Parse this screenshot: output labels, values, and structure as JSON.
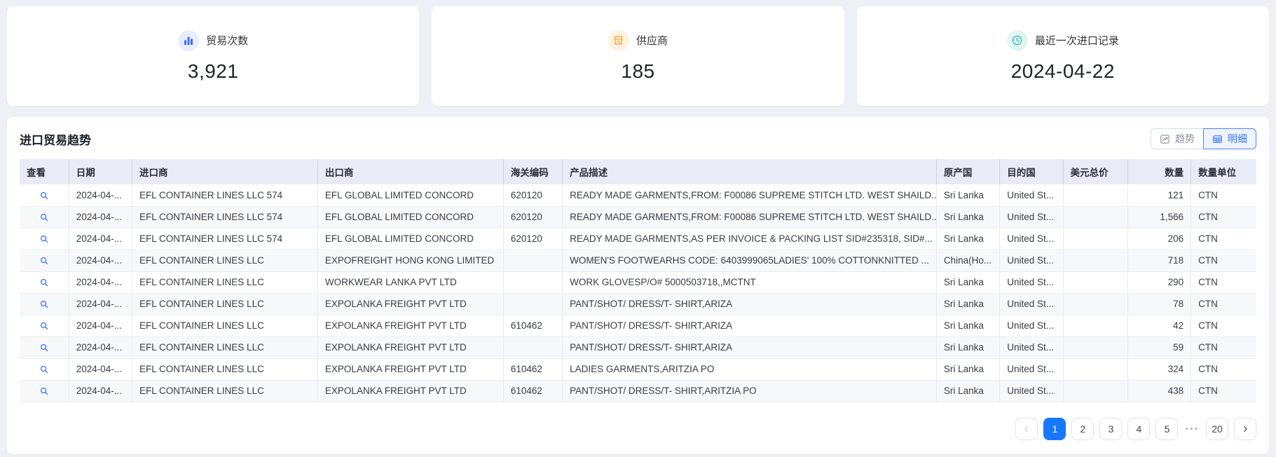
{
  "cards": [
    {
      "icon": "bar-chart-icon",
      "label": "贸易次数",
      "value": "3,921"
    },
    {
      "icon": "store-icon",
      "label": "供应商",
      "value": "185"
    },
    {
      "icon": "clock-icon",
      "label": "最近一次进口记录",
      "value": "2024-04-22"
    }
  ],
  "panel": {
    "title": "进口贸易趋势",
    "view_toggle": {
      "trend_label": "趋势",
      "detail_label": "明细",
      "active": "明细"
    }
  },
  "table": {
    "columns": [
      "查看",
      "日期",
      "进口商",
      "出口商",
      "海关编码",
      "产品描述",
      "原产国",
      "目的国",
      "美元总价",
      "数量",
      "数量单位"
    ],
    "rows": [
      {
        "date": "2024-04-...",
        "importer": "EFL CONTAINER LINES LLC 574",
        "exporter": "EFL GLOBAL LIMITED CONCORD",
        "hs_code": "620120",
        "description": "READY MADE GARMENTS,FROM: F00086 SUPREME STITCH LTD. WEST SHAILD...",
        "origin_country": "Sri Lanka",
        "dest_country": "United St...",
        "usd_total": "",
        "quantity": "121",
        "unit": "CTN"
      },
      {
        "date": "2024-04-...",
        "importer": "EFL CONTAINER LINES LLC 574",
        "exporter": "EFL GLOBAL LIMITED CONCORD",
        "hs_code": "620120",
        "description": "READY MADE GARMENTS,FROM: F00086 SUPREME STITCH LTD. WEST SHAILD...",
        "origin_country": "Sri Lanka",
        "dest_country": "United St...",
        "usd_total": "",
        "quantity": "1,566",
        "unit": "CTN"
      },
      {
        "date": "2024-04-...",
        "importer": "EFL CONTAINER LINES LLC 574",
        "exporter": "EFL GLOBAL LIMITED CONCORD",
        "hs_code": "620120",
        "description": "READY MADE GARMENTS,AS PER INVOICE & PACKING LIST SID#235318, SID#...",
        "origin_country": "Sri Lanka",
        "dest_country": "United St...",
        "usd_total": "",
        "quantity": "206",
        "unit": "CTN"
      },
      {
        "date": "2024-04-...",
        "importer": "EFL CONTAINER LINES LLC",
        "exporter": "EXPOFREIGHT HONG KONG LIMITED",
        "hs_code": "",
        "description": "WOMEN'S FOOTWEARHS CODE: 6403999065LADIES' 100% COTTONKNITTED ...",
        "origin_country": "China(Ho...",
        "dest_country": "United St...",
        "usd_total": "",
        "quantity": "718",
        "unit": "CTN"
      },
      {
        "date": "2024-04-...",
        "importer": "EFL CONTAINER LINES LLC",
        "exporter": "WORKWEAR LANKA PVT LTD",
        "hs_code": "",
        "description": "WORK GLOVESP/O# 5000503718,,MCTNT",
        "origin_country": "Sri Lanka",
        "dest_country": "United St...",
        "usd_total": "",
        "quantity": "290",
        "unit": "CTN"
      },
      {
        "date": "2024-04-...",
        "importer": "EFL CONTAINER LINES LLC",
        "exporter": "EXPOLANKA FREIGHT PVT LTD",
        "hs_code": "",
        "description": "PANT/SHOT/ DRESS/T- SHIRT,ARIZA",
        "origin_country": "Sri Lanka",
        "dest_country": "United St...",
        "usd_total": "",
        "quantity": "78",
        "unit": "CTN"
      },
      {
        "date": "2024-04-...",
        "importer": "EFL CONTAINER LINES LLC",
        "exporter": "EXPOLANKA FREIGHT PVT LTD",
        "hs_code": "610462",
        "description": "PANT/SHOT/ DRESS/T- SHIRT,ARIZA",
        "origin_country": "Sri Lanka",
        "dest_country": "United St...",
        "usd_total": "",
        "quantity": "42",
        "unit": "CTN"
      },
      {
        "date": "2024-04-...",
        "importer": "EFL CONTAINER LINES LLC",
        "exporter": "EXPOLANKA FREIGHT PVT LTD",
        "hs_code": "",
        "description": "PANT/SHOT/ DRESS/T- SHIRT,ARIZA",
        "origin_country": "Sri Lanka",
        "dest_country": "United St...",
        "usd_total": "",
        "quantity": "59",
        "unit": "CTN"
      },
      {
        "date": "2024-04-...",
        "importer": "EFL CONTAINER LINES LLC",
        "exporter": "EXPOLANKA FREIGHT PVT LTD",
        "hs_code": "610462",
        "description": "LADIES GARMENTS,ARITZIA PO",
        "origin_country": "Sri Lanka",
        "dest_country": "United St...",
        "usd_total": "",
        "quantity": "324",
        "unit": "CTN"
      },
      {
        "date": "2024-04-...",
        "importer": "EFL CONTAINER LINES LLC",
        "exporter": "EXPOLANKA FREIGHT PVT LTD",
        "hs_code": "610462",
        "description": "PANT/SHOT/ DRESS/T- SHIRT,ARITZIA PO",
        "origin_country": "Sri Lanka",
        "dest_country": "United St...",
        "usd_total": "",
        "quantity": "438",
        "unit": "CTN"
      }
    ]
  },
  "pagination": {
    "pages": [
      "1",
      "2",
      "3",
      "4",
      "5"
    ],
    "active_page": "1",
    "ellipsis": "•••",
    "last_page": "20"
  },
  "colors": {
    "accent_blue": "#3370ff",
    "pagination_active_blue": "#1677ff",
    "icon_orange": "#f0a33a",
    "icon_teal": "#2bb8b8",
    "header_bg": "#e9ecf6"
  }
}
